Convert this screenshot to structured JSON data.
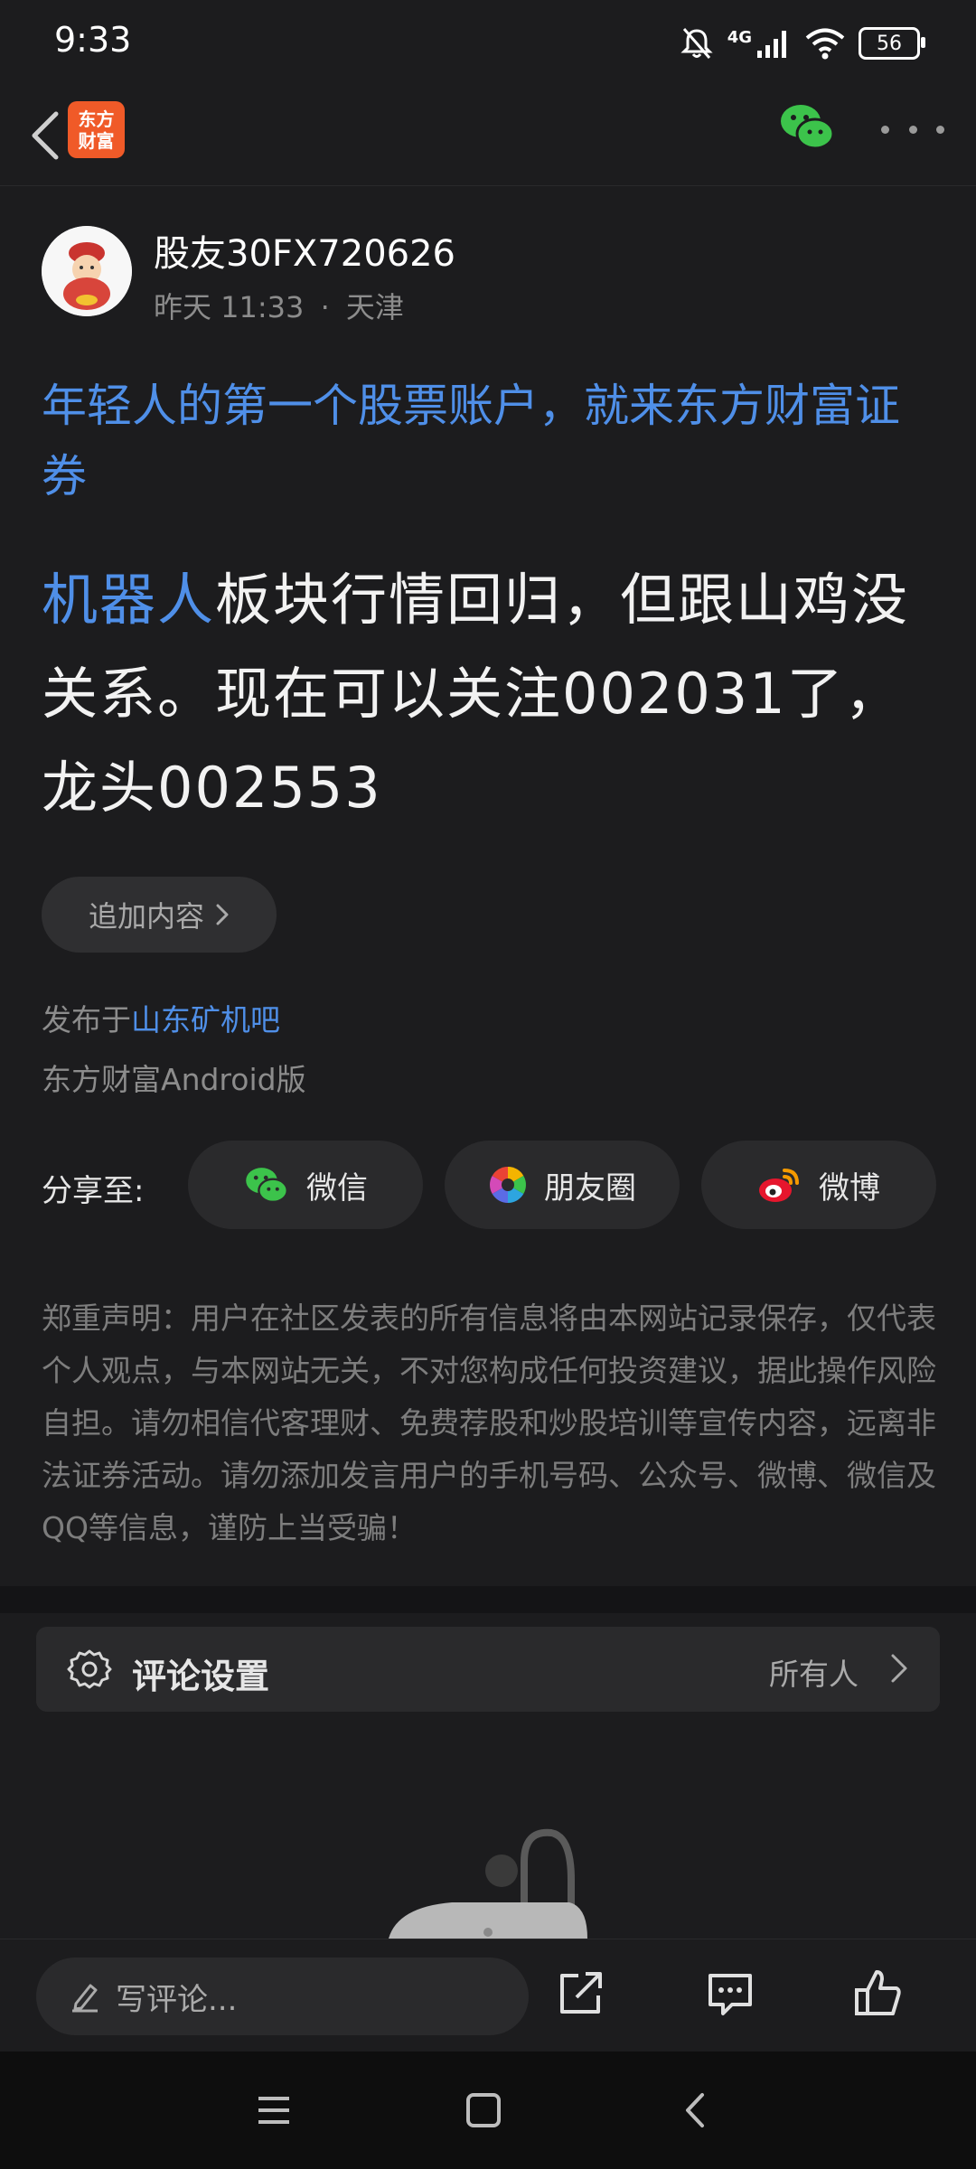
{
  "status_bar": {
    "time": "9:33",
    "network": "4G",
    "battery": "56"
  },
  "header": {
    "logo_line1": "东方",
    "logo_line2": "财富"
  },
  "author": {
    "name": "股友30FX720626",
    "time": "昨天 11:33",
    "separator": "·",
    "location": "天津"
  },
  "ad_text": "年轻人的第一个股票账户，就来东方财富证券",
  "post": {
    "keyword": "机器人",
    "text": "板块行情回归，但跟山鸡没关系。现在可以关注002031了，龙头002553"
  },
  "append_button": "追加内容",
  "publish": {
    "prefix": "发布于",
    "forum": "山东矿机吧",
    "client": "东方财富Android版"
  },
  "share": {
    "label": "分享至:",
    "wechat": "微信",
    "moments": "朋友圈",
    "weibo": "微博"
  },
  "disclaimer": "郑重声明：用户在社区发表的所有信息将由本网站记录保存，仅代表个人观点，与本网站无关，不对您构成任何投资建议，据此操作风险自担。请勿相信代客理财、免费荐股和炒股培训等宣传内容，远离非法证券活动。请勿添加发言用户的手机号码、公众号、微博、微信及QQ等信息，谨防上当受骗！",
  "comment_settings": {
    "title": "评论设置",
    "value": "所有人"
  },
  "bottom": {
    "comment_placeholder": "写评论..."
  },
  "colors": {
    "accent": "#4f8fe8",
    "logo": "#f05a28",
    "wechat": "#3cc34b",
    "background": "#1c1c1e"
  }
}
